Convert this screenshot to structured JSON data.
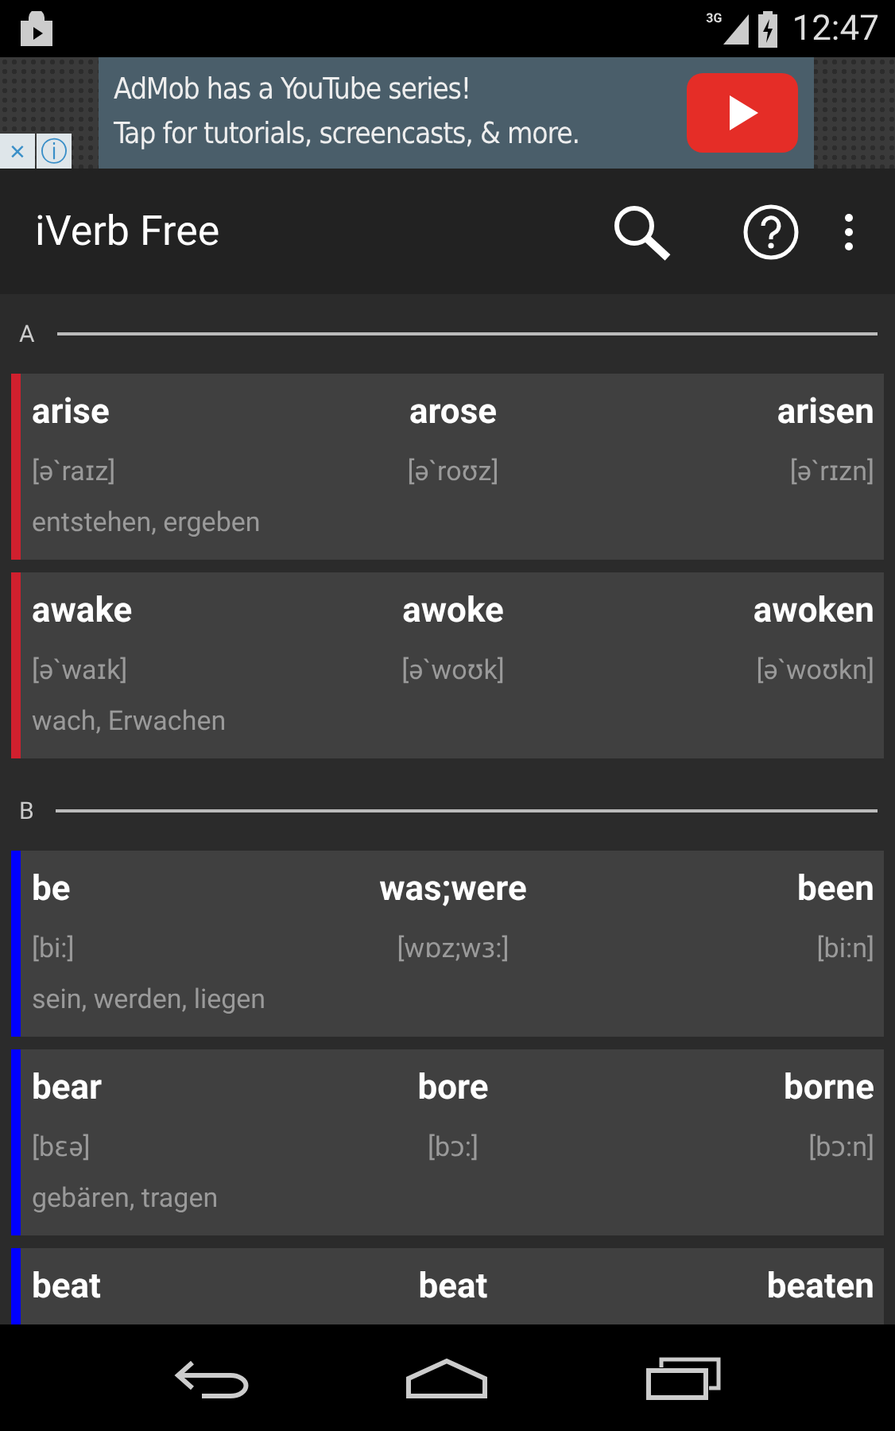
{
  "status_bar": {
    "time": "12:47",
    "network": "3G"
  },
  "ad": {
    "line_1": "AdMob has a YouTube series!",
    "line_2": "Tap for tutorials, screencasts, & more.",
    "close": "×",
    "info": "ⓘ"
  },
  "app_bar": {
    "title": "iVerb Free"
  },
  "sections": [
    {
      "letter": "A",
      "verbs": [
        {
          "color": "#d0202e",
          "forms": [
            "arise",
            "arose",
            "arisen"
          ],
          "phonetics": [
            "[ə`raɪz]",
            "[ə`roʊz]",
            "[ə`rɪzn]"
          ],
          "translation": "entstehen, ergeben"
        },
        {
          "color": "#d0202e",
          "forms": [
            "awake",
            "awoke",
            "awoken"
          ],
          "phonetics": [
            "[ə`waɪk]",
            "[ə`woʊk]",
            "[ə`woʊkn]"
          ],
          "translation": "wach, Erwachen"
        }
      ]
    },
    {
      "letter": "B",
      "verbs": [
        {
          "color": "#0000ff",
          "forms": [
            "be",
            "was;were",
            "been"
          ],
          "phonetics": [
            "[bi:]",
            "[wɒz;wɜ:]",
            "[bi:n]"
          ],
          "translation": "sein, werden, liegen"
        },
        {
          "color": "#0000ff",
          "forms": [
            "bear",
            "bore",
            "borne"
          ],
          "phonetics": [
            "[bɛə]",
            "[bɔ:]",
            "[bɔ:n]"
          ],
          "translation": "gebären, tragen"
        },
        {
          "color": "#0000ff",
          "forms": [
            "beat",
            "beat",
            "beaten"
          ]
        }
      ]
    }
  ]
}
